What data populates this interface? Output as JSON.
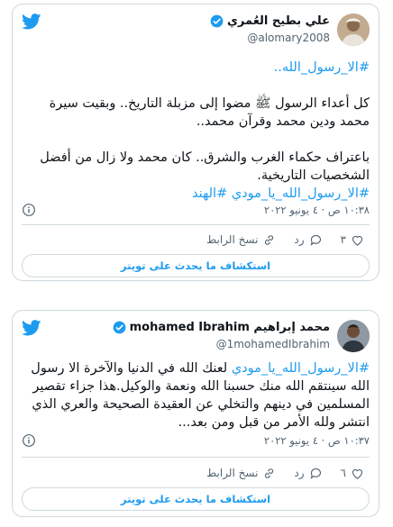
{
  "tweets": [
    {
      "author_name": "علي بطيح العُمري",
      "handle": "@alomary2008",
      "paragraphs": [
        [
          {
            "text": "#الا_رسول_الله..",
            "link": true
          }
        ],
        [
          {
            "text": "كل أعداء الرسول ﷺ مضوا إلى مزبلة التاريخ.. وبقيت سيرة محمد ودين محمد وقرآن محمد..",
            "link": false
          }
        ],
        [
          {
            "text": "باعتراف حكماء الغرب والشرق.. كان محمد ولا زال من أفضل الشخصيات التاريخية.",
            "link": false
          }
        ],
        [
          {
            "text": "#الا_رسول_الله_يا_مودي #الهند",
            "link": true
          }
        ]
      ],
      "timestamp": "١٠:٣٨ ص · ٤ يونيو ٢٠٢٢",
      "like_count": "٣",
      "reply_label": "رد",
      "copy_link_label": "نسخ الرابط",
      "explore_label": "استكشاف ما يحدث على تويتر"
    },
    {
      "author_name": "محمد إبراهيم mohamed Ibrahim",
      "handle": "@1mohamedIbrahim",
      "paragraphs": [
        [
          {
            "text": "#الا_رسول_الله_يا_مودي",
            "link": true
          },
          {
            "text": " لعنك الله في الدنيا والآخرة الا رسول الله سينتقم الله منك حسبنا الله ونعمة والوكيل.هذا جزاء تقصير المسلمين في دينهم والتخلي عن العقيدة الصحيحة والعري الذي انتشر ولله الأمر من قبل ومن بعد...",
            "link": false
          }
        ]
      ],
      "timestamp": "١٠:٣٧ ص · ٤ يونيو ٢٠٢٢",
      "like_count": "٦",
      "reply_label": "رد",
      "copy_link_label": "نسخ الرابط",
      "explore_label": "استكشاف ما يحدث على تويتر"
    }
  ],
  "icons": {
    "brand": "twitter-bird-icon",
    "verified": "verified-badge-icon",
    "info": "info-icon",
    "like": "heart-icon",
    "reply": "reply-bubble-icon",
    "copy_link": "link-icon"
  },
  "colors": {
    "accent": "#1d9bf0",
    "text": "#0f1419",
    "muted": "#536471",
    "border": "#cfd9de"
  }
}
